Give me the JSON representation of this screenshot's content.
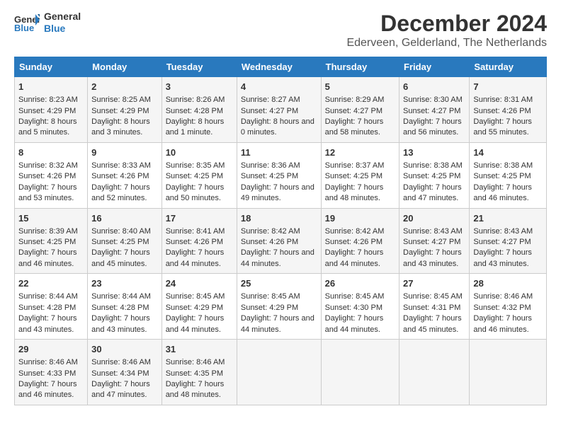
{
  "header": {
    "logo_line1": "General",
    "logo_line2": "Blue",
    "title": "December 2024",
    "subtitle": "Ederveen, Gelderland, The Netherlands"
  },
  "columns": [
    "Sunday",
    "Monday",
    "Tuesday",
    "Wednesday",
    "Thursday",
    "Friday",
    "Saturday"
  ],
  "rows": [
    [
      {
        "day": "1",
        "sunrise": "Sunrise: 8:23 AM",
        "sunset": "Sunset: 4:29 PM",
        "daylight": "Daylight: 8 hours and 5 minutes."
      },
      {
        "day": "2",
        "sunrise": "Sunrise: 8:25 AM",
        "sunset": "Sunset: 4:29 PM",
        "daylight": "Daylight: 8 hours and 3 minutes."
      },
      {
        "day": "3",
        "sunrise": "Sunrise: 8:26 AM",
        "sunset": "Sunset: 4:28 PM",
        "daylight": "Daylight: 8 hours and 1 minute."
      },
      {
        "day": "4",
        "sunrise": "Sunrise: 8:27 AM",
        "sunset": "Sunset: 4:27 PM",
        "daylight": "Daylight: 8 hours and 0 minutes."
      },
      {
        "day": "5",
        "sunrise": "Sunrise: 8:29 AM",
        "sunset": "Sunset: 4:27 PM",
        "daylight": "Daylight: 7 hours and 58 minutes."
      },
      {
        "day": "6",
        "sunrise": "Sunrise: 8:30 AM",
        "sunset": "Sunset: 4:27 PM",
        "daylight": "Daylight: 7 hours and 56 minutes."
      },
      {
        "day": "7",
        "sunrise": "Sunrise: 8:31 AM",
        "sunset": "Sunset: 4:26 PM",
        "daylight": "Daylight: 7 hours and 55 minutes."
      }
    ],
    [
      {
        "day": "8",
        "sunrise": "Sunrise: 8:32 AM",
        "sunset": "Sunset: 4:26 PM",
        "daylight": "Daylight: 7 hours and 53 minutes."
      },
      {
        "day": "9",
        "sunrise": "Sunrise: 8:33 AM",
        "sunset": "Sunset: 4:26 PM",
        "daylight": "Daylight: 7 hours and 52 minutes."
      },
      {
        "day": "10",
        "sunrise": "Sunrise: 8:35 AM",
        "sunset": "Sunset: 4:25 PM",
        "daylight": "Daylight: 7 hours and 50 minutes."
      },
      {
        "day": "11",
        "sunrise": "Sunrise: 8:36 AM",
        "sunset": "Sunset: 4:25 PM",
        "daylight": "Daylight: 7 hours and 49 minutes."
      },
      {
        "day": "12",
        "sunrise": "Sunrise: 8:37 AM",
        "sunset": "Sunset: 4:25 PM",
        "daylight": "Daylight: 7 hours and 48 minutes."
      },
      {
        "day": "13",
        "sunrise": "Sunrise: 8:38 AM",
        "sunset": "Sunset: 4:25 PM",
        "daylight": "Daylight: 7 hours and 47 minutes."
      },
      {
        "day": "14",
        "sunrise": "Sunrise: 8:38 AM",
        "sunset": "Sunset: 4:25 PM",
        "daylight": "Daylight: 7 hours and 46 minutes."
      }
    ],
    [
      {
        "day": "15",
        "sunrise": "Sunrise: 8:39 AM",
        "sunset": "Sunset: 4:25 PM",
        "daylight": "Daylight: 7 hours and 46 minutes."
      },
      {
        "day": "16",
        "sunrise": "Sunrise: 8:40 AM",
        "sunset": "Sunset: 4:25 PM",
        "daylight": "Daylight: 7 hours and 45 minutes."
      },
      {
        "day": "17",
        "sunrise": "Sunrise: 8:41 AM",
        "sunset": "Sunset: 4:26 PM",
        "daylight": "Daylight: 7 hours and 44 minutes."
      },
      {
        "day": "18",
        "sunrise": "Sunrise: 8:42 AM",
        "sunset": "Sunset: 4:26 PM",
        "daylight": "Daylight: 7 hours and 44 minutes."
      },
      {
        "day": "19",
        "sunrise": "Sunrise: 8:42 AM",
        "sunset": "Sunset: 4:26 PM",
        "daylight": "Daylight: 7 hours and 44 minutes."
      },
      {
        "day": "20",
        "sunrise": "Sunrise: 8:43 AM",
        "sunset": "Sunset: 4:27 PM",
        "daylight": "Daylight: 7 hours and 43 minutes."
      },
      {
        "day": "21",
        "sunrise": "Sunrise: 8:43 AM",
        "sunset": "Sunset: 4:27 PM",
        "daylight": "Daylight: 7 hours and 43 minutes."
      }
    ],
    [
      {
        "day": "22",
        "sunrise": "Sunrise: 8:44 AM",
        "sunset": "Sunset: 4:28 PM",
        "daylight": "Daylight: 7 hours and 43 minutes."
      },
      {
        "day": "23",
        "sunrise": "Sunrise: 8:44 AM",
        "sunset": "Sunset: 4:28 PM",
        "daylight": "Daylight: 7 hours and 43 minutes."
      },
      {
        "day": "24",
        "sunrise": "Sunrise: 8:45 AM",
        "sunset": "Sunset: 4:29 PM",
        "daylight": "Daylight: 7 hours and 44 minutes."
      },
      {
        "day": "25",
        "sunrise": "Sunrise: 8:45 AM",
        "sunset": "Sunset: 4:29 PM",
        "daylight": "Daylight: 7 hours and 44 minutes."
      },
      {
        "day": "26",
        "sunrise": "Sunrise: 8:45 AM",
        "sunset": "Sunset: 4:30 PM",
        "daylight": "Daylight: 7 hours and 44 minutes."
      },
      {
        "day": "27",
        "sunrise": "Sunrise: 8:45 AM",
        "sunset": "Sunset: 4:31 PM",
        "daylight": "Daylight: 7 hours and 45 minutes."
      },
      {
        "day": "28",
        "sunrise": "Sunrise: 8:46 AM",
        "sunset": "Sunset: 4:32 PM",
        "daylight": "Daylight: 7 hours and 46 minutes."
      }
    ],
    [
      {
        "day": "29",
        "sunrise": "Sunrise: 8:46 AM",
        "sunset": "Sunset: 4:33 PM",
        "daylight": "Daylight: 7 hours and 46 minutes."
      },
      {
        "day": "30",
        "sunrise": "Sunrise: 8:46 AM",
        "sunset": "Sunset: 4:34 PM",
        "daylight": "Daylight: 7 hours and 47 minutes."
      },
      {
        "day": "31",
        "sunrise": "Sunrise: 8:46 AM",
        "sunset": "Sunset: 4:35 PM",
        "daylight": "Daylight: 7 hours and 48 minutes."
      },
      null,
      null,
      null,
      null
    ]
  ]
}
